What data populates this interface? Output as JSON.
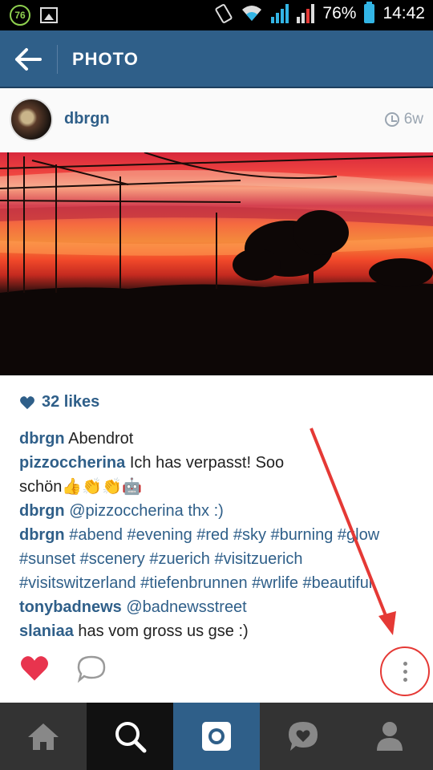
{
  "status_bar": {
    "notification_badge": "76",
    "battery_percent": "76%",
    "time": "14:42"
  },
  "app_bar": {
    "title": "PHOTO"
  },
  "post": {
    "username": "dbrgn",
    "age": "6w",
    "likes": "32 likes",
    "comments": [
      {
        "user": "dbrgn",
        "text": "Abendrot"
      },
      {
        "user": "pizzoccherina",
        "text": "Ich has verpasst!  Soo",
        "continuation": "schön👍👏👏🤖"
      },
      {
        "user": "dbrgn",
        "text": "@pizzoccherina thx :)"
      },
      {
        "user": "dbrgn",
        "text": "#abend #evening #red #sky #burning #glow",
        "line2": "#sunset #scenery #zuerich #visitzuerich",
        "line3": "#visitswitzerland #tiefenbrunnen #wrlife #beautiful"
      },
      {
        "user": "tonybadnews",
        "text": "@badnewsstreet"
      },
      {
        "user": "slaniaa",
        "text": "has vom gross us gse :)"
      }
    ]
  },
  "colors": {
    "brand_blue": "#2f5f89",
    "heart_red": "#e8344e",
    "annotation_red": "#e53935"
  },
  "icons": {
    "back": "back-arrow-icon",
    "clock": "clock-icon",
    "heart": "heart-icon",
    "comment": "comment-bubble-icon",
    "more": "more-vertical-icon",
    "nav": [
      "home-icon",
      "search-icon",
      "camera-icon",
      "news-heart-icon",
      "profile-icon"
    ]
  }
}
